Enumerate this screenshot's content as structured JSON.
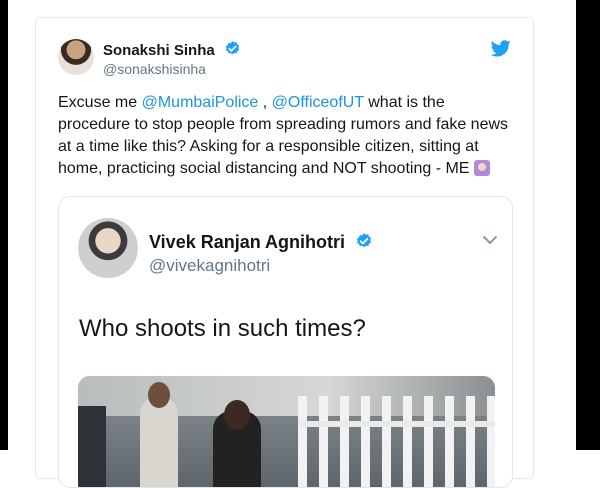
{
  "tweet": {
    "author_name": "Sonakshi Sinha",
    "author_handle": "@sonakshisinha",
    "text": {
      "part1": "Excuse me ",
      "mention1": "@MumbaiPolice",
      "part2": " , ",
      "mention2": "@OfficeofUT",
      "part3": " what is the procedure to stop people from spreading rumors and fake news at a time like this? Asking for a responsible citizen, sitting at home, practicing social distancing and NOT shooting - ME "
    }
  },
  "quoted_tweet": {
    "author_name": "Vivek Ranjan Agnihotri",
    "author_handle": "@vivekagnihotri",
    "text": "Who shoots in such times?"
  },
  "icons": {
    "verified": "verified-badge-icon",
    "twitter": "twitter-bird-icon",
    "chevron": "chevron-down-icon",
    "emoji": "woman-raising-hand-emoji"
  },
  "colors": {
    "link": "#1b95e0",
    "verified": "#1da1f2",
    "text": "#14171a",
    "secondary": "#657786"
  }
}
